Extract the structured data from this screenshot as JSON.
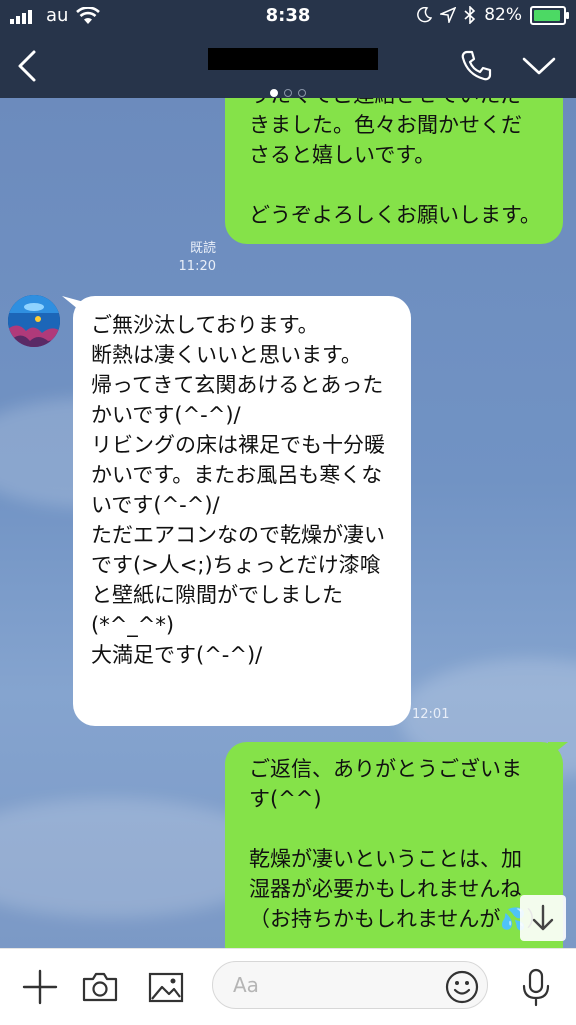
{
  "status_bar": {
    "carrier": "au",
    "time": "8:38",
    "battery": "82%",
    "battery_level": 0.82
  },
  "header": {
    "page_count": 3,
    "active_page": 0
  },
  "messages": [
    {
      "sender": "me",
      "text": "りたくてご連絡させていただきました。色々お聞かせくださると嬉しいです。\n\nどうぞよろしくお願いします。",
      "read_label": "既読",
      "time": "11:20"
    },
    {
      "sender": "them",
      "text": "ご無沙汰しております。\n断熱は凄くいいと思います。\n帰ってきて玄関あけるとあったかいです(^-^)/\nリビングの床は裸足でも十分暖かいです。またお風呂も寒くないです(^-^)/\nただエアコンなので乾燥が凄いです(>人<;)ちょっとだけ漆喰と壁紙に隙間がでしました(*^_^*)\n大満足です(^-^)/",
      "time": "12:01"
    },
    {
      "sender": "me",
      "text": "ご返信、ありがとうございます(^^)\n\n乾燥が凄いということは、加湿器が必要かもしれませんね（お持ちかもしれませんが💦）"
    }
  ],
  "input": {
    "placeholder": "Aa"
  },
  "colors": {
    "header_bg": "#27344a",
    "my_bubble": "#85e249",
    "their_bubble": "#ffffff",
    "chat_bg": "#7193c4"
  }
}
